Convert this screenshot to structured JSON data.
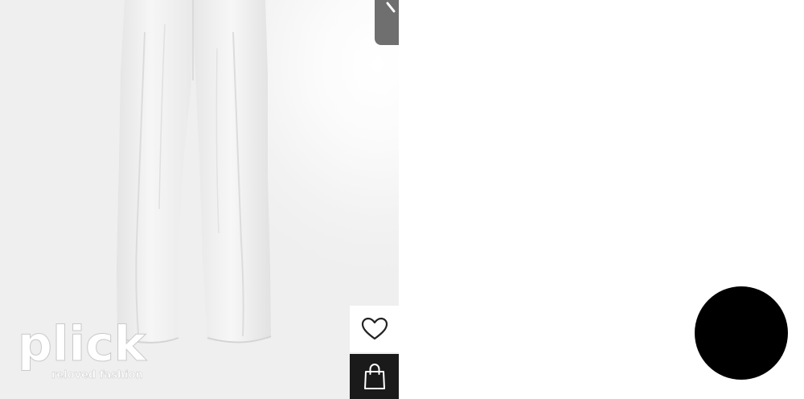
{
  "product": {
    "image_alt": "",
    "item": "white-linen-trousers"
  },
  "watermark": {
    "brand": "plick",
    "tagline": "reloved fashion"
  },
  "actions": {
    "wishlist_icon": "heart-outline-icon",
    "bag_icon": "shopping-bag-icon",
    "corner_icon": "arrow-icon"
  },
  "chat": {
    "icon": "chat-bubble-button"
  },
  "colors": {
    "image_bg": "#f2f2f2",
    "corner_tab": "#6f6f6f",
    "bag_button": "#1a1a1a",
    "chat_bubble": "#000000"
  }
}
